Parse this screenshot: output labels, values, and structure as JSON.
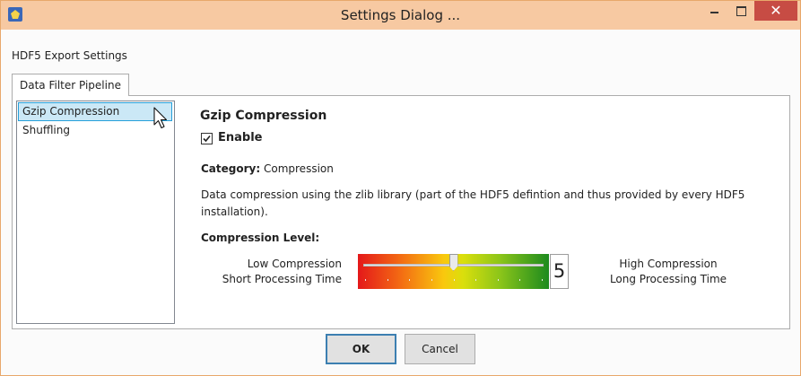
{
  "window": {
    "title": "Settings Dialog ...",
    "controls": {
      "minimize": "minimize-icon",
      "maximize": "maximize-icon",
      "close": "close-icon"
    }
  },
  "section_label": "HDF5 Export Settings",
  "tabs": [
    {
      "label": "Data Filter Pipeline",
      "active": true
    }
  ],
  "filters": {
    "items": [
      {
        "label": "Gzip Compression",
        "selected": true
      },
      {
        "label": "Shuffling",
        "selected": false
      }
    ]
  },
  "filter": {
    "heading": "Gzip Compression",
    "enable": {
      "label": "Enable",
      "checked": true
    },
    "category_label": "Category:",
    "category_value": "Compression",
    "description": "Data compression using the zlib library (part of the HDF5 defintion and thus provided by every HDF5 installation).",
    "level_label": "Compression Level:",
    "low_line1": "Low Compression",
    "low_line2": "Short Processing Time",
    "high_line1": "High Compression",
    "high_line2": "Long Processing Time",
    "level": {
      "min": 1,
      "max": 9,
      "value": 5
    },
    "gradient_colors": [
      "#e4181a",
      "#f36a13",
      "#f9c80e",
      "#dadf0c",
      "#89c41a",
      "#1c8a1e"
    ]
  },
  "buttons": {
    "ok": "OK",
    "cancel": "Cancel"
  },
  "colors": {
    "titlebar": "#f7c9a2",
    "close_button": "#c74c44",
    "selection": "#cbe8f6",
    "ok_border": "#3c7fb1"
  }
}
